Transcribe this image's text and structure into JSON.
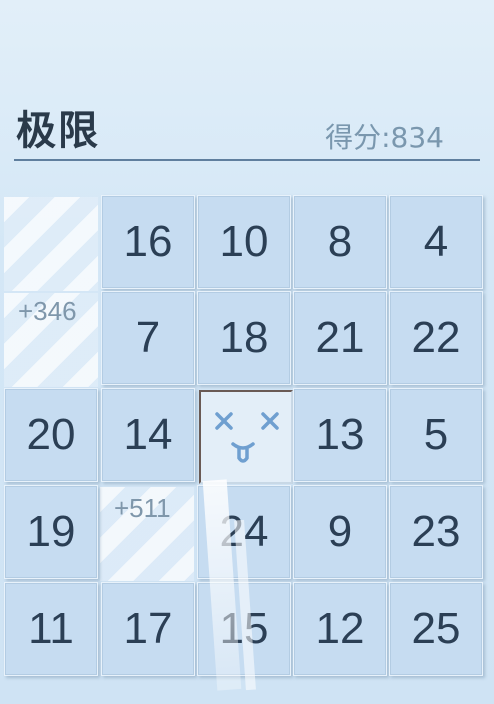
{
  "header": {
    "title": "极限",
    "score_label": "得分:834"
  },
  "board": {
    "rows": [
      [
        "",
        "16",
        "10",
        "8",
        "4"
      ],
      [
        "",
        "7",
        "18",
        "21",
        "22"
      ],
      [
        "20",
        "14",
        "",
        "13",
        "5"
      ],
      [
        "19",
        "",
        "24",
        "9",
        "23"
      ],
      [
        "11",
        "17",
        "15",
        "12",
        "25"
      ]
    ],
    "bonuses": [
      "+346",
      "+511"
    ],
    "empty_slot_icon": "dizzy-face-icon"
  }
}
